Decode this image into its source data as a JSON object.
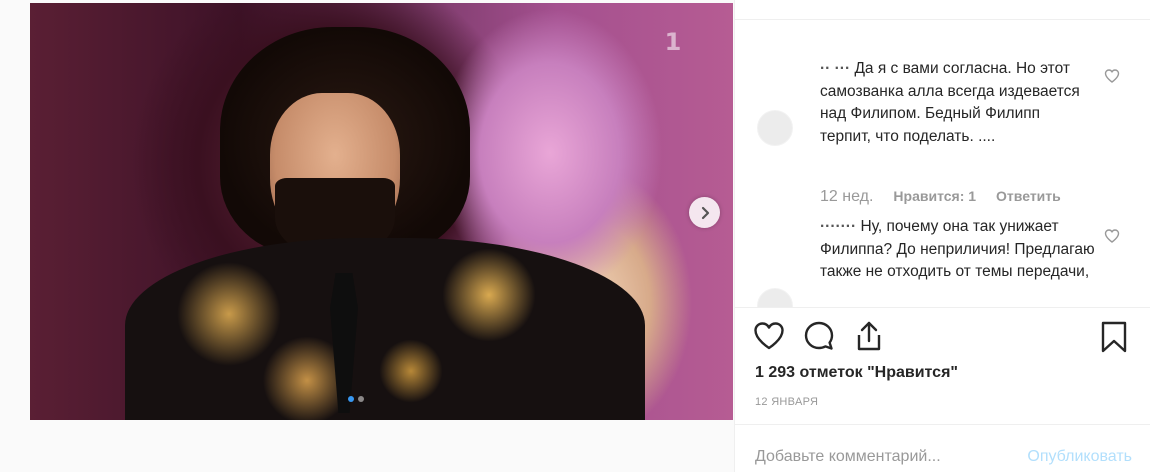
{
  "media": {
    "channel_logo": "1",
    "carousel_dots": 2,
    "active_dot": 0
  },
  "comments": [
    {
      "username": "·· ···",
      "text": "Да я с вами согласна. Но этот самозванка алла всегда издевается над Филипом. Бедный Филипп терпит, что поделать. ....",
      "time": "12 нед.",
      "likes": "Нравится: 1",
      "reply": "Ответить"
    },
    {
      "username": "·······",
      "text": "Ну, почему она так унижает Филиппа? До неприличия! Предлагаю также не отходить от темы передачи,"
    }
  ],
  "actions": {
    "like_icon": "heart-icon",
    "comment_icon": "comment-icon",
    "share_icon": "share-icon",
    "save_icon": "bookmark-icon"
  },
  "likes_text": "1 293 отметок \"Нравится\"",
  "date_text": "12 ЯНВАРЯ",
  "add_comment_placeholder": "Добавьте комментарий...",
  "post_label": "Опубликовать"
}
